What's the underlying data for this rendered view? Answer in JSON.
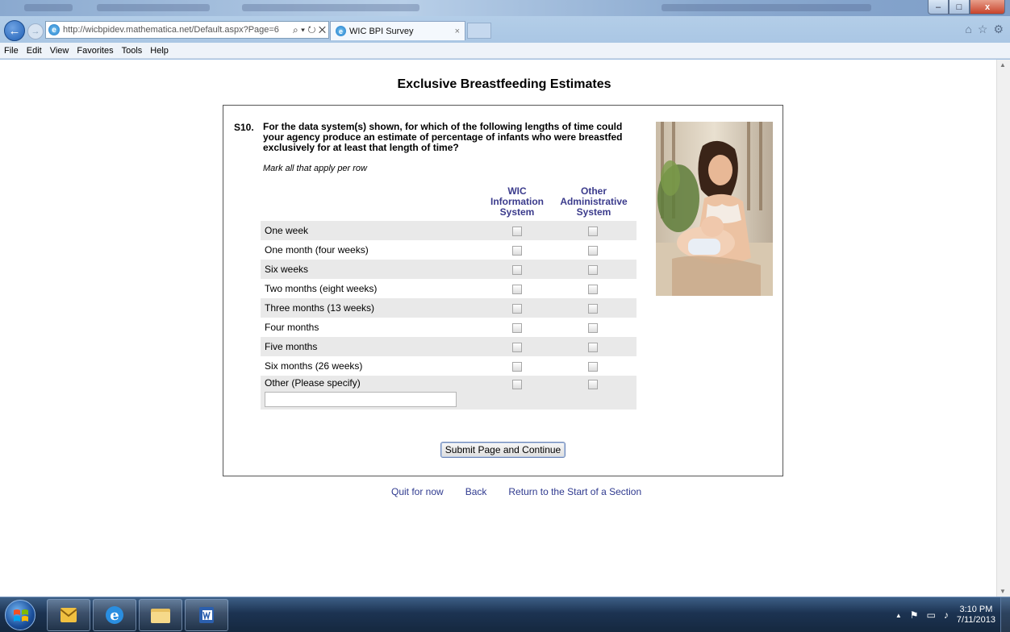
{
  "browser": {
    "address_url": "http://wicbpidev.mathematica.net/Default.aspx?Page=6",
    "address_controls": "⌕ ▾ ↻ ✕",
    "tab_title": "WIC BPI Survey",
    "tab_close": "×",
    "menu": [
      "File",
      "Edit",
      "View",
      "Favorites",
      "Tools",
      "Help"
    ],
    "right_icons": [
      "⌂",
      "☆",
      "⚙"
    ],
    "window_buttons": {
      "minimize": "–",
      "maximize": "□",
      "close": "x"
    }
  },
  "page": {
    "title": "Exclusive Breastfeeding Estimates",
    "question_number": "S10.",
    "question_text": "For the data system(s) shown, for which of the following lengths of time could your agency produce an estimate of percentage of infants who were breastfed exclusively for at least that length of time?",
    "instruction": "Mark all that apply per row",
    "columns": [
      "WIC Information System",
      "Other Administrative System"
    ],
    "rows": [
      {
        "label": "One week"
      },
      {
        "label": "One month (four weeks)"
      },
      {
        "label": "Six weeks"
      },
      {
        "label": "Two months (eight weeks)"
      },
      {
        "label": "Three months (13 weeks)"
      },
      {
        "label": "Four months"
      },
      {
        "label": "Five months"
      },
      {
        "label": "Six months (26 weeks)"
      },
      {
        "label": "Other  (Please specify)"
      }
    ],
    "other_specify_value": "",
    "submit_label": "Submit Page and Continue",
    "footer_links": [
      "Quit for now",
      "Back",
      "Return to the Start of a Section"
    ]
  },
  "taskbar": {
    "time": "3:10 PM",
    "date": "7/11/2013",
    "tray_arrow": "▲",
    "tray_icons": [
      "⚑",
      "▭",
      "♪"
    ]
  },
  "colors": {
    "column_header": "#3b3b8c",
    "link": "#2f3a8f",
    "row_shade": "#e9e9e9"
  }
}
